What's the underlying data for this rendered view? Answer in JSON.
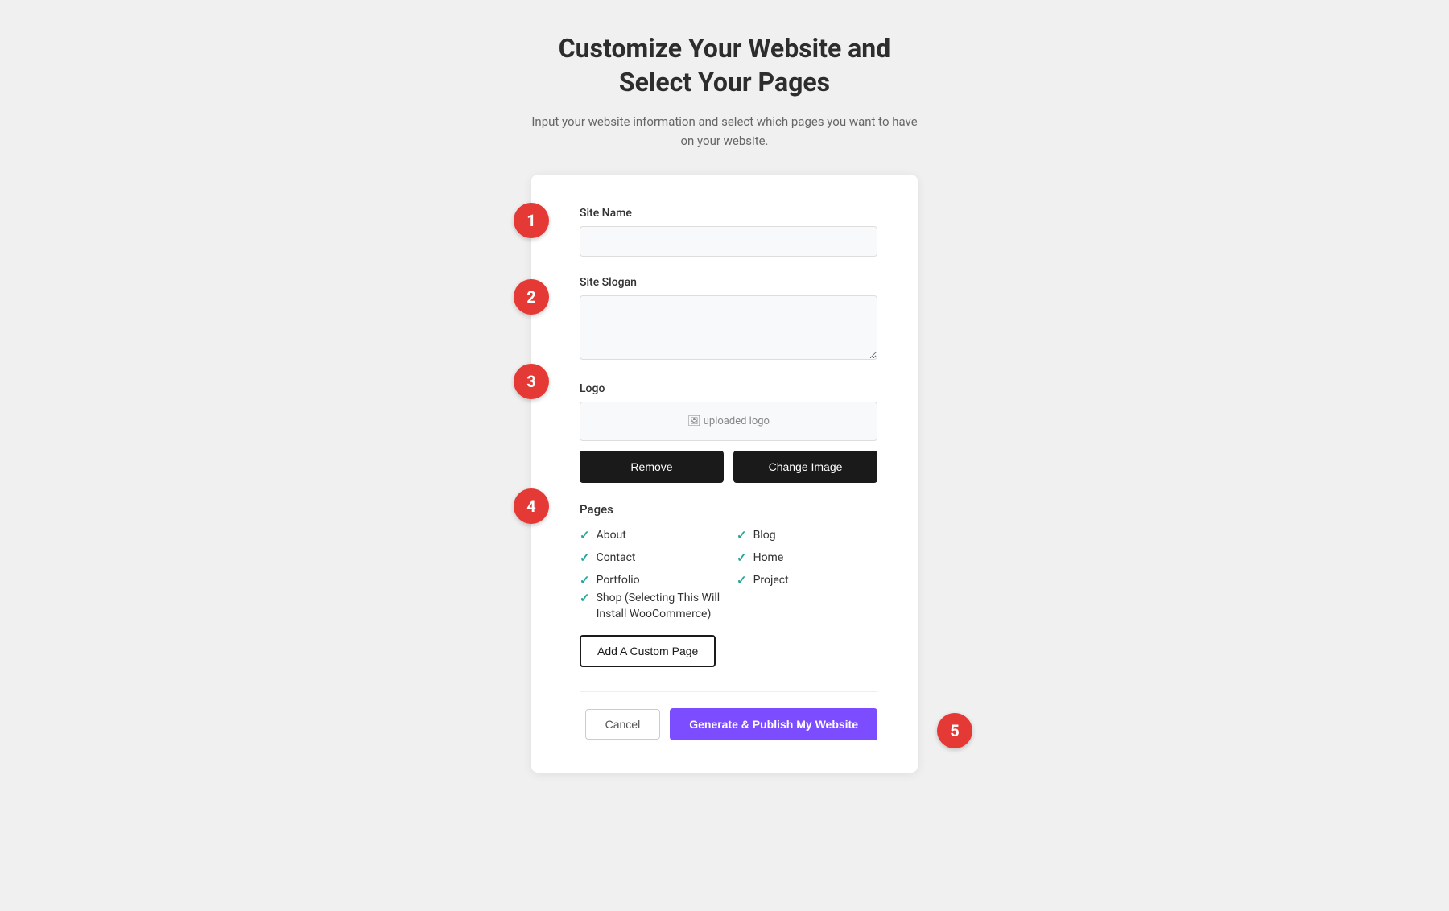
{
  "header": {
    "title": "Customize Your Website and\nSelect Your Pages",
    "subtitle": "Input your website information and select which pages you want to have\non your website."
  },
  "steps": {
    "1": "1",
    "2": "2",
    "3": "3",
    "4": "4",
    "5": "5"
  },
  "form": {
    "site_name_label": "Site Name",
    "site_name_placeholder": "",
    "site_slogan_label": "Site Slogan",
    "site_slogan_placeholder": "",
    "logo_label": "Logo",
    "logo_preview_text": "uploaded logo",
    "remove_button": "Remove",
    "change_image_button": "Change Image",
    "pages_label": "Pages",
    "pages": [
      {
        "name": "About",
        "checked": true
      },
      {
        "name": "Blog",
        "checked": true
      },
      {
        "name": "Contact",
        "checked": true
      },
      {
        "name": "Home",
        "checked": true
      },
      {
        "name": "Portfolio",
        "checked": true
      },
      {
        "name": "Project",
        "checked": true
      }
    ],
    "shop_page": {
      "name": "Shop (Selecting This Will Install WooCommerce)",
      "checked": true
    },
    "add_custom_page_button": "Add A Custom Page",
    "cancel_button": "Cancel",
    "publish_button": "Generate & Publish My Website"
  }
}
